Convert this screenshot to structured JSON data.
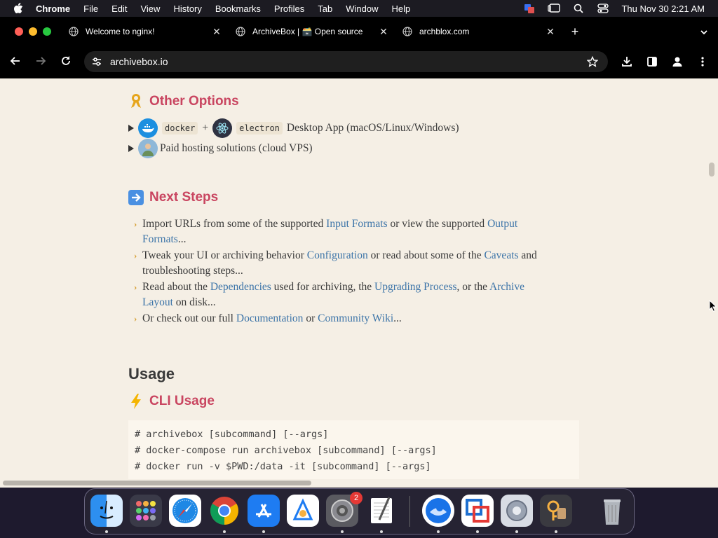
{
  "menubar": {
    "app": "Chrome",
    "items": [
      "File",
      "Edit",
      "View",
      "History",
      "Bookmarks",
      "Profiles",
      "Tab",
      "Window",
      "Help"
    ],
    "clock": "Thu Nov 30  2:21 AM"
  },
  "tabs": [
    {
      "title": "Welcome to nginx!"
    },
    {
      "title": "ArchiveBox | 🗃️ Open source"
    },
    {
      "title": "archblox.com"
    }
  ],
  "address": {
    "url": "archivebox.io"
  },
  "page": {
    "other_options": {
      "heading": "Other Options",
      "docker_code": "docker",
      "plus": "+",
      "electron_code": "electron",
      "desktop_text": "Desktop App (macOS/Linux/Windows)",
      "hosting_text": "Paid hosting solutions (cloud VPS)"
    },
    "next_steps": {
      "heading": "Next Steps",
      "items": [
        {
          "a": "Import URLs from some of the supported ",
          "l1": "Input Formats",
          "b": " or view the supported ",
          "l2": "Output",
          "c": "",
          "l3": "Formats",
          "d": "..."
        },
        {
          "a": "Tweak your UI or archiving behavior ",
          "l1": "Configuration",
          "b": " or read about some of the ",
          "l2": "Caveats",
          "c": " and",
          "l3": "",
          "d": "troubleshooting steps..."
        },
        {
          "a": "Read about the ",
          "l1": "Dependencies",
          "b": " used for archiving, the ",
          "l2": "Upgrading Process",
          "c": ", or the ",
          "l3": "Archive",
          "d": "Layout",
          "e": " on disk..."
        },
        {
          "a": "Or check out our full ",
          "l1": "Documentation",
          "b": " or ",
          "l2": "Community Wiki",
          "c": "..."
        }
      ]
    },
    "usage": {
      "heading": "Usage"
    },
    "cli": {
      "heading": "CLI Usage",
      "lines": [
        "# archivebox [subcommand] [--args]",
        "# docker-compose run archivebox [subcommand] [--args]",
        "# docker run -v $PWD:/data -it [subcommand] [--args]"
      ]
    }
  },
  "dock": {
    "settings_badge": "2"
  }
}
